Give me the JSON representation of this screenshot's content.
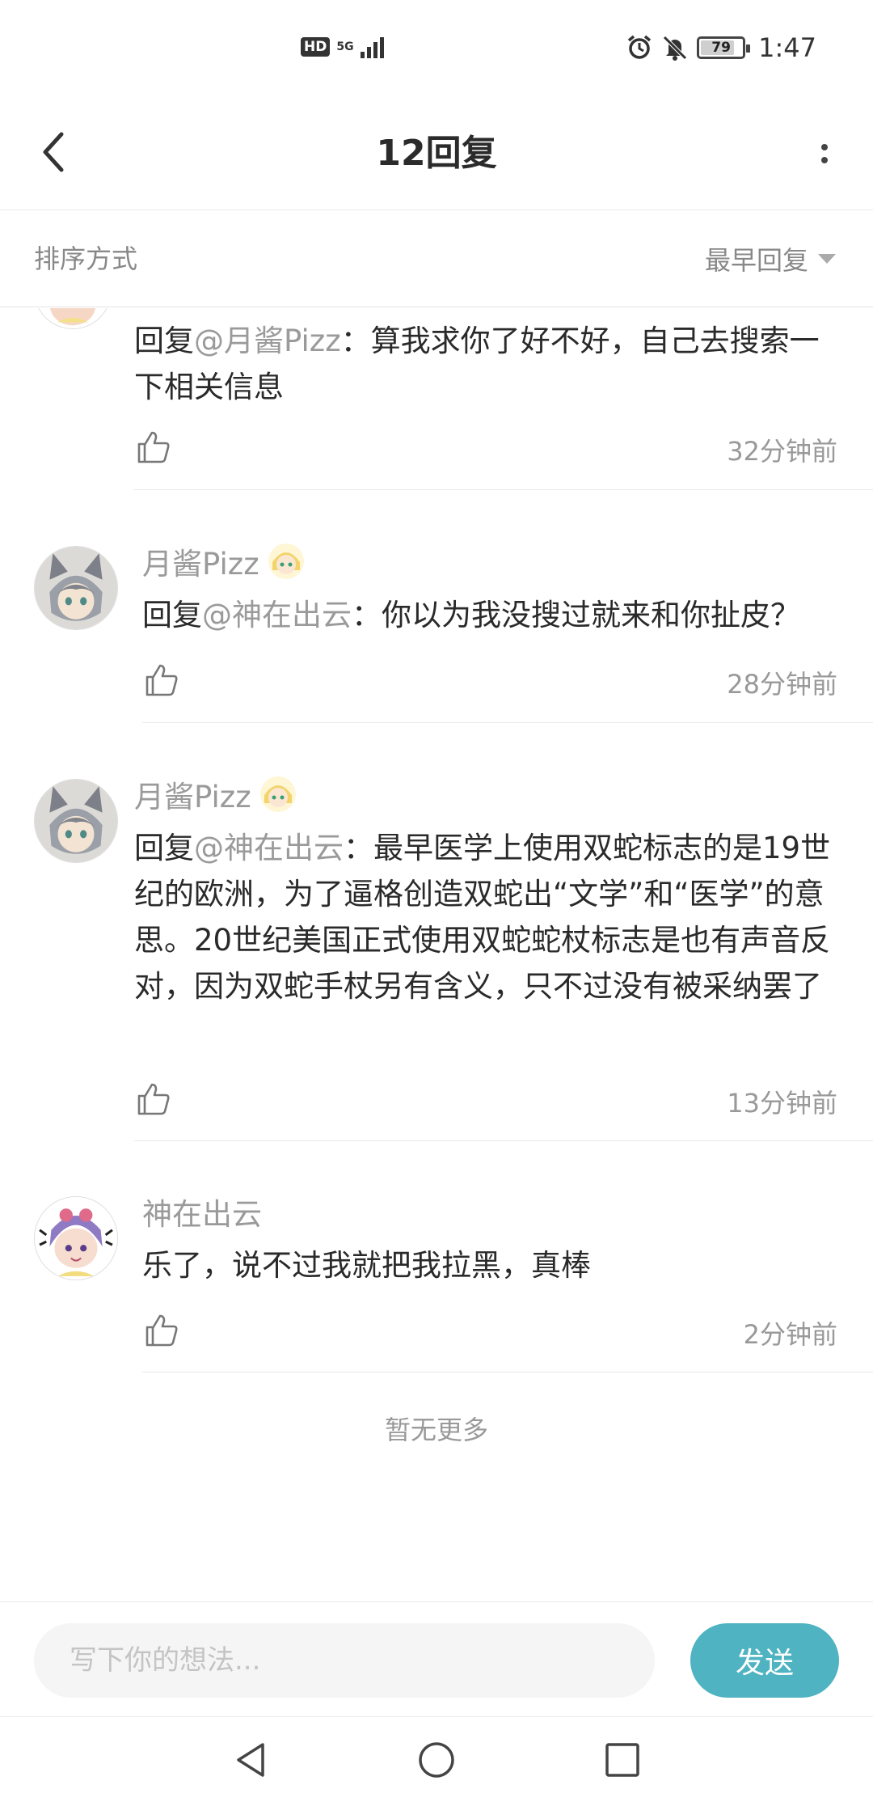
{
  "status_bar": {
    "hd": "HD",
    "network": "5G",
    "battery": "79",
    "time": "1:47"
  },
  "header": {
    "title": "12回复"
  },
  "sort": {
    "label": "排序方式",
    "selected": "最早回复"
  },
  "comments": [
    {
      "prefix": "回复",
      "mention": "@月酱Pizz",
      "text": "：算我求你了好不好，自己去搜索一下相关信息",
      "time": "32分钟前"
    },
    {
      "user": "月酱Pizz",
      "prefix": "回复",
      "mention": "@神在出云",
      "text": "：你以为我没搜过就来和你扯皮？",
      "time": "28分钟前"
    },
    {
      "user": "月酱Pizz",
      "prefix": "回复",
      "mention": "@神在出云",
      "text": "：最早医学上使用双蛇标志的是19世纪的欧洲，为了逼格创造双蛇出“文学”和“医学”的意思。20世纪美国正式使用双蛇蛇杖标志是也有声音反对，因为双蛇手杖另有含义，只不过没有被采纳罢了",
      "time": "13分钟前"
    },
    {
      "user": "神在出云",
      "text": "乐了，说不过我就把我拉黑，真棒",
      "time": "2分钟前"
    }
  ],
  "footer": {
    "no_more": "暂无更多",
    "input_placeholder": "写下你的想法...",
    "send_label": "发送"
  }
}
